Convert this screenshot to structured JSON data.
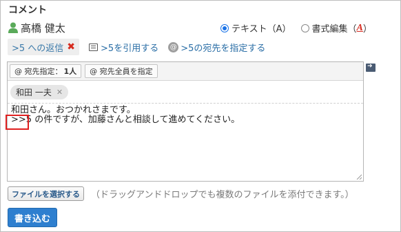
{
  "form": {
    "title": "コメント",
    "user": {
      "icon": "user-icon",
      "name": "高橋 健太"
    },
    "mode": {
      "text_label": "テキスト（A）",
      "rich_label": "書式編集（",
      "rich_shortcut": "A",
      "rich_suffix": "）",
      "selected": "text"
    },
    "reply": {
      "chip_label": ">5 への返信",
      "remove_icon": "close-icon",
      "quote_link": ">5を引用する",
      "addressee_link": ">5の宛先を指定する"
    },
    "editor": {
      "toolbar": {
        "addressee_count_label": "宛先指定：",
        "addressee_count": "1人",
        "all_addressees_label": "宛先全員を指定"
      },
      "addressees": [
        "和田 一夫"
      ],
      "body_lines": [
        "和田さん。おつかれさまです。",
        ">>5 の件ですが、加藤さんと相談して進めてください。"
      ]
    },
    "attachments": {
      "button_label": "ファイルを選択する",
      "hint": "（ドラッグアンドドロップでも複数のファイルを添付できます。）"
    },
    "submit_label": "書き込む"
  },
  "colors": {
    "accent": "#2e7fcf",
    "link": "#2a6ea6",
    "remove": "#d62b1f",
    "highlight": "#e02020",
    "user_icon": "#5aaa5a"
  }
}
